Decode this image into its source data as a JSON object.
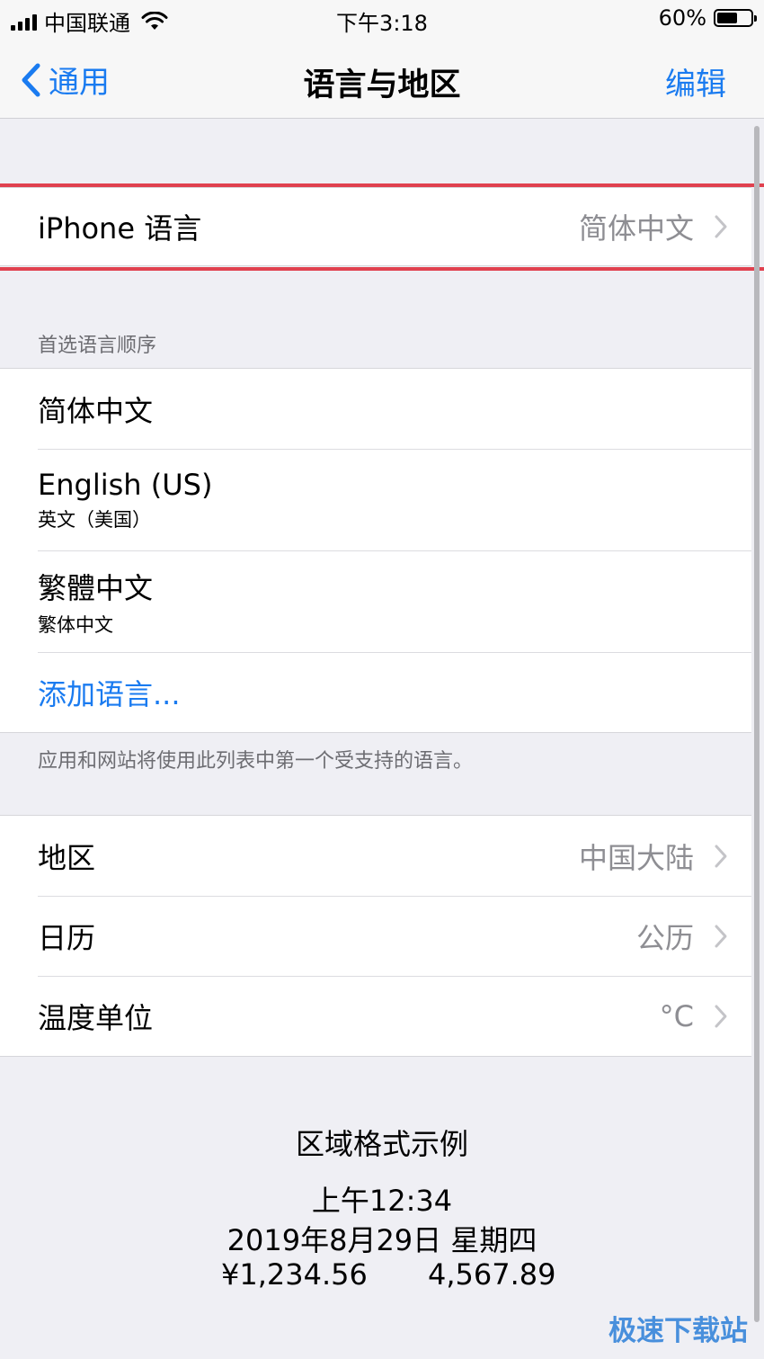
{
  "status_bar": {
    "carrier": "中国联通",
    "time": "下午3:18",
    "battery_text": "60%",
    "battery_level": 0.6
  },
  "nav": {
    "back_label": "通用",
    "title": "语言与地区",
    "edit_label": "编辑"
  },
  "iphone_language": {
    "label": "iPhone 语言",
    "value": "简体中文"
  },
  "preferred_languages": {
    "header": "首选语言顺序",
    "items": [
      {
        "name": "简体中文",
        "sub": ""
      },
      {
        "name": "English (US)",
        "sub": "英文（美国）"
      },
      {
        "name": "繁體中文",
        "sub": "繁体中文"
      }
    ],
    "add_label": "添加语言...",
    "footer": "应用和网站将使用此列表中第一个受支持的语言。"
  },
  "region_settings": [
    {
      "label": "地区",
      "value": "中国大陆"
    },
    {
      "label": "日历",
      "value": "公历"
    },
    {
      "label": "温度单位",
      "value": "°C"
    }
  ],
  "format_example": {
    "title": "区域格式示例",
    "time": "上午12:34",
    "date": "2019年8月29日 星期四",
    "currency": "¥1,234.56",
    "number": "4,567.89"
  },
  "watermark": "极速下载站",
  "colors": {
    "accent": "#1a7bf0",
    "highlight": "#e0414f",
    "secondary_text": "#8e8e93"
  }
}
